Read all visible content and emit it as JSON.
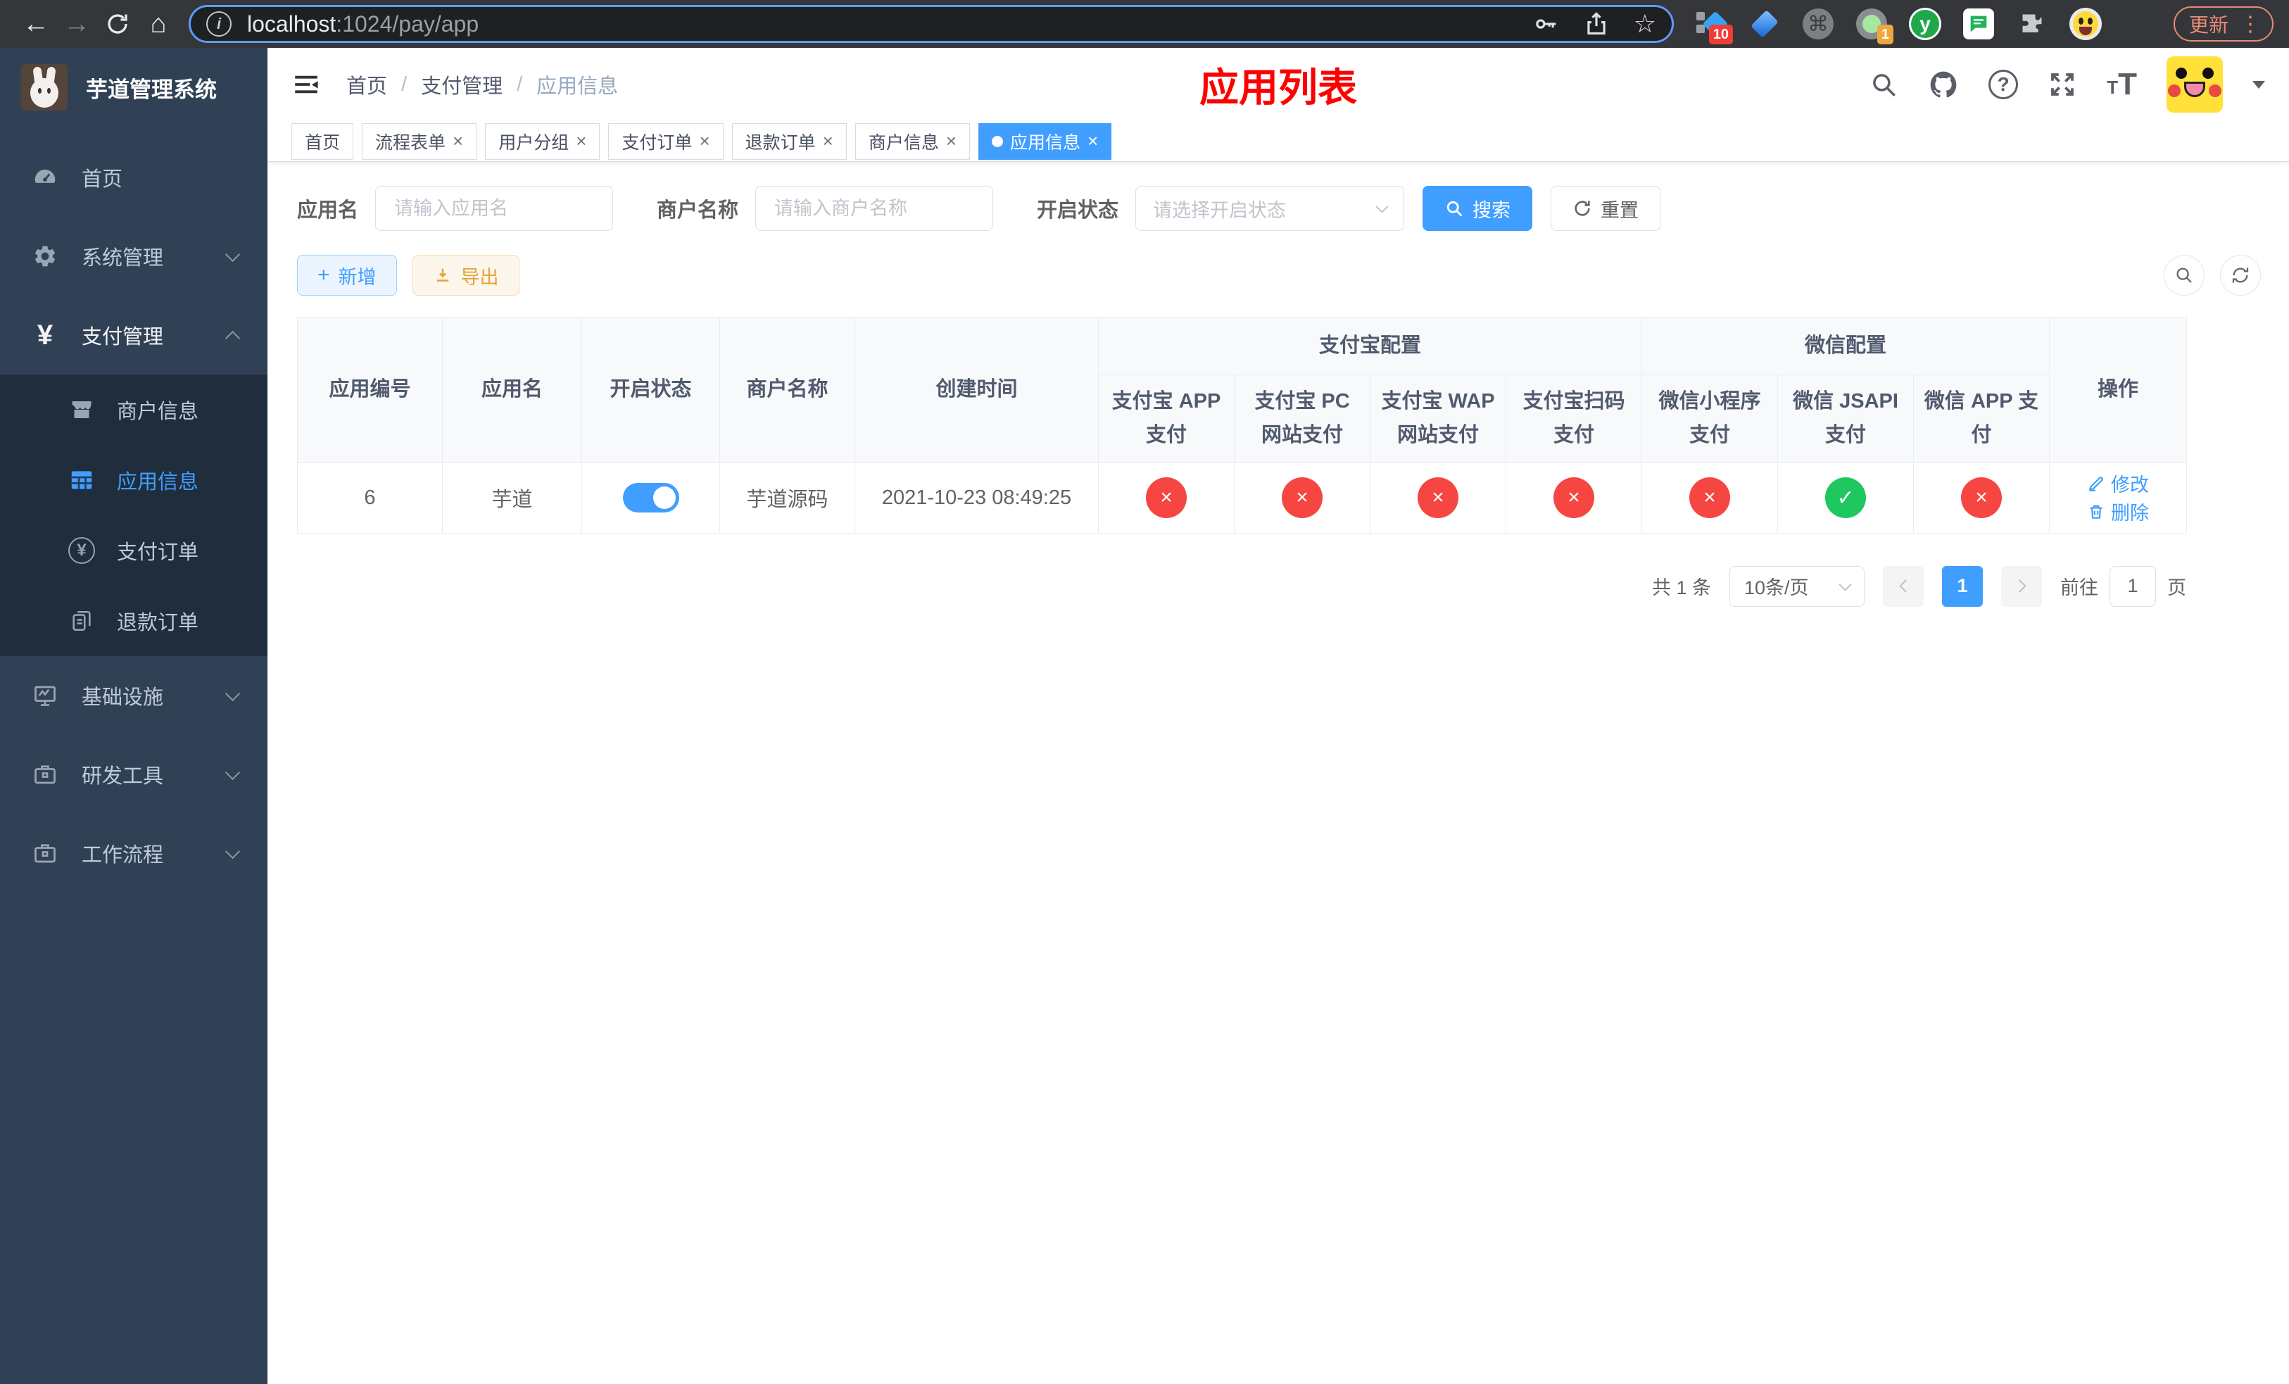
{
  "browser": {
    "url_host": "localhost",
    "url_path": ":1024/pay/app",
    "update_label": "更新",
    "ext_badge_1": "10",
    "ext_badge_2": "1",
    "ext_y_label": "y"
  },
  "icons": {
    "back": "←",
    "forward": "→",
    "home": "⌂",
    "info": "i",
    "star": "☆",
    "command": "⌘",
    "dots": "⋮",
    "question": "?",
    "close": "×",
    "breadcrumb_sep": "/",
    "yen": "¥",
    "plus": "+",
    "font_small": "T",
    "font_big": "T"
  },
  "sidebar": {
    "logo_title": "芋道管理系统",
    "items": [
      {
        "label": "首页"
      },
      {
        "label": "系统管理"
      },
      {
        "label": "支付管理"
      },
      {
        "label": "基础设施"
      },
      {
        "label": "研发工具"
      },
      {
        "label": "工作流程"
      }
    ],
    "payment_submenu": [
      {
        "label": "商户信息"
      },
      {
        "label": "应用信息",
        "active": true
      },
      {
        "label": "支付订单"
      },
      {
        "label": "退款订单"
      }
    ]
  },
  "header": {
    "breadcrumb": [
      "首页",
      "支付管理",
      "应用信息"
    ],
    "page_title": "应用列表"
  },
  "tabs": [
    {
      "label": "首页",
      "closable": false,
      "active": false
    },
    {
      "label": "流程表单",
      "closable": true,
      "active": false
    },
    {
      "label": "用户分组",
      "closable": true,
      "active": false
    },
    {
      "label": "支付订单",
      "closable": true,
      "active": false
    },
    {
      "label": "退款订单",
      "closable": true,
      "active": false
    },
    {
      "label": "商户信息",
      "closable": true,
      "active": false
    },
    {
      "label": "应用信息",
      "closable": true,
      "active": true
    }
  ],
  "filters": {
    "app_name_label": "应用名",
    "app_name_placeholder": "请输入应用名",
    "merchant_label": "商户名称",
    "merchant_placeholder": "请输入商户名称",
    "status_label": "开启状态",
    "status_placeholder": "请选择开启状态",
    "search_label": "搜索",
    "reset_label": "重置"
  },
  "toolbar": {
    "add_label": "新增",
    "export_label": "导出"
  },
  "table": {
    "headers": {
      "app_id": "应用编号",
      "app_name": "应用名",
      "status": "开启状态",
      "merchant": "商户名称",
      "create_time": "创建时间",
      "alipay_group": "支付宝配置",
      "wechat_group": "微信配置",
      "alipay_app": "支付宝 APP 支付",
      "alipay_pc": "支付宝 PC 网站支付",
      "alipay_wap": "支付宝 WAP 网站支付",
      "alipay_scan": "支付宝扫码支付",
      "wechat_lite": "微信小程序支付",
      "wechat_jsapi": "微信 JSAPI 支付",
      "wechat_app": "微信 APP 支付",
      "actions": "操作"
    },
    "rows": [
      {
        "app_id": "6",
        "app_name": "芋道",
        "status_on": true,
        "merchant": "芋道源码",
        "create_time": "2021-10-23 08:49:25",
        "channels": [
          {
            "state": "fail",
            "glyph": "×"
          },
          {
            "state": "fail",
            "glyph": "×"
          },
          {
            "state": "fail",
            "glyph": "×"
          },
          {
            "state": "fail",
            "glyph": "×"
          },
          {
            "state": "fail",
            "glyph": "×"
          },
          {
            "state": "success",
            "glyph": "✓"
          },
          {
            "state": "fail",
            "glyph": "×"
          }
        ],
        "edit_label": "修改",
        "delete_label": "删除"
      }
    ]
  },
  "pagination": {
    "total_text": "共 1 条",
    "page_size": "10条/页",
    "current_page": "1",
    "goto_label": "前往",
    "goto_value": "1",
    "page_label": "页"
  },
  "colors": {
    "accent_blue": "#409eff",
    "success_green": "#1ec85f",
    "fail_red": "#f54641",
    "title_red": "#fd0000",
    "sidebar_bg": "#304156",
    "submenu_bg": "#1f2d3d"
  }
}
